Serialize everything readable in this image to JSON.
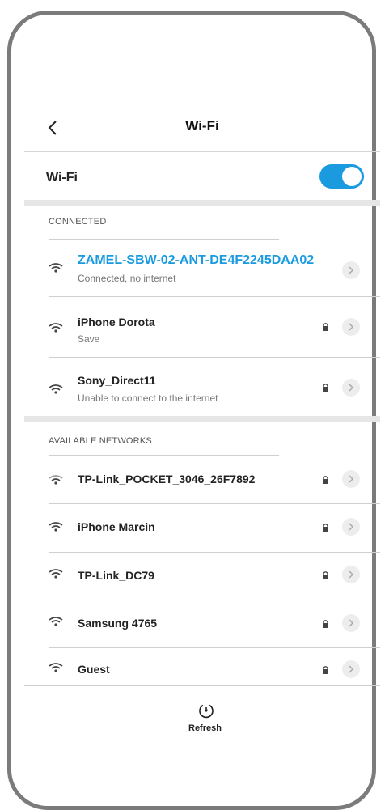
{
  "header": {
    "title": "Wi-Fi"
  },
  "wifi_toggle": {
    "label": "Wi-Fi",
    "state": "on"
  },
  "sections": {
    "connected_label": "CONNECTED",
    "available_label": "AVAILABLE NETWORKS"
  },
  "connected": [
    {
      "name": "ZAMEL-SBW-02-ANT-DE4F2245DAA02",
      "status": "Connected, no internet",
      "locked": false
    },
    {
      "name": "iPhone Dorota",
      "status": "Save",
      "locked": true
    },
    {
      "name": "Sony_Direct11",
      "status": "Unable to connect to the internet",
      "locked": true
    }
  ],
  "available": [
    {
      "name": "TP-Link_POCKET_3046_26F7892",
      "locked": true
    },
    {
      "name": "iPhone Marcin",
      "locked": true
    },
    {
      "name": "TP-Link_DC79",
      "locked": true
    },
    {
      "name": "Samsung 4765",
      "locked": true
    },
    {
      "name": "Guest",
      "locked": true
    }
  ],
  "footer": {
    "refresh_label": "Refresh",
    "icon": "refresh-icon"
  },
  "colors": {
    "accent": "#1a9be0",
    "divider": "#d6d6d6",
    "chevron_bg": "#ededed"
  }
}
